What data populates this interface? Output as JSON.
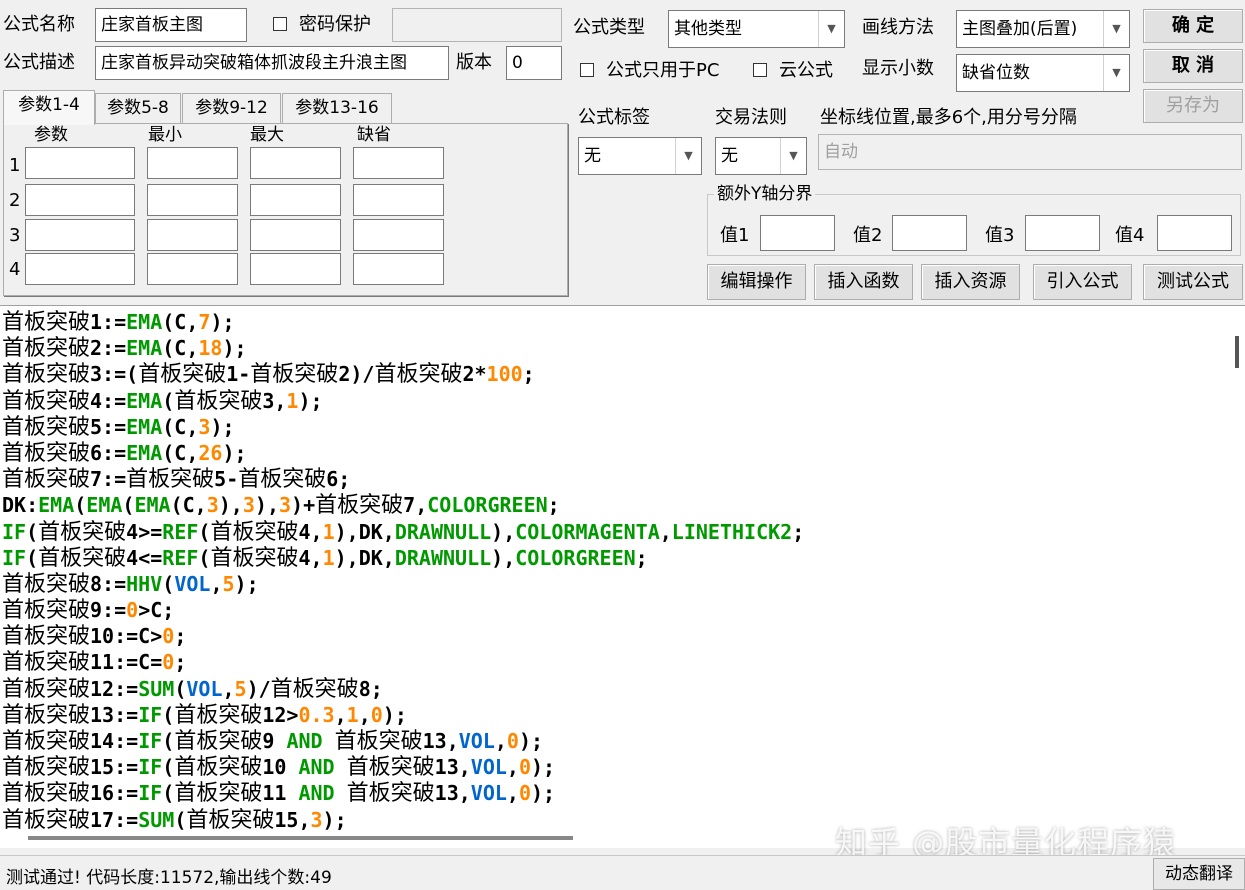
{
  "form": {
    "name_label": "公式名称",
    "name_value": "庄家首板主图",
    "password_label": "密码保护",
    "desc_label": "公式描述",
    "desc_value": "庄家首板异动突破箱体抓波段主升浪主图",
    "version_label": "版本",
    "version_value": "0",
    "type_label": "公式类型",
    "type_value": "其他类型",
    "draw_label": "画线方法",
    "draw_value": "主图叠加(后置)",
    "pc_only_label": "公式只用于PC",
    "cloud_label": "云公式",
    "decimals_label": "显示小数",
    "decimals_value": "缺省位数",
    "tag_label": "公式标签",
    "tag_value": "无",
    "trade_label": "交易法则",
    "trade_value": "无",
    "axis_label": "坐标线位置,最多6个,用分号分隔",
    "axis_value": "自动",
    "extra_y_title": "额外Y轴分界",
    "val1": "值1",
    "val2": "值2",
    "val3": "值3",
    "val4": "值4"
  },
  "buttons": {
    "ok": "确 定",
    "cancel": "取 消",
    "save_as": "另存为",
    "edit_ops": "编辑操作",
    "insert_func": "插入函数",
    "insert_res": "插入资源",
    "import_formula": "引入公式",
    "test_formula": "测试公式"
  },
  "tabs": [
    "参数1-4",
    "参数5-8",
    "参数9-12",
    "参数13-16"
  ],
  "param_headers": [
    "参数",
    "最小",
    "最大",
    "缺省"
  ],
  "param_rows": [
    "1",
    "2",
    "3",
    "4"
  ],
  "code_lines": [
    [
      [
        "c",
        "首板突破"
      ],
      [
        "t",
        "1:="
      ],
      [
        "f",
        "EMA"
      ],
      [
        "t",
        "(C,"
      ],
      [
        "n",
        "7"
      ],
      [
        "t",
        ");"
      ]
    ],
    [
      [
        "c",
        "首板突破"
      ],
      [
        "t",
        "2:="
      ],
      [
        "f",
        "EMA"
      ],
      [
        "t",
        "(C,"
      ],
      [
        "n",
        "18"
      ],
      [
        "t",
        ");"
      ]
    ],
    [
      [
        "c",
        "首板突破"
      ],
      [
        "t",
        "3:=("
      ],
      [
        "c",
        "首板突破"
      ],
      [
        "t",
        "1-"
      ],
      [
        "c",
        "首板突破"
      ],
      [
        "t",
        "2)/"
      ],
      [
        "c",
        "首板突破"
      ],
      [
        "t",
        "2*"
      ],
      [
        "n",
        "100"
      ],
      [
        "t",
        ";"
      ]
    ],
    [
      [
        "c",
        "首板突破"
      ],
      [
        "t",
        "4:="
      ],
      [
        "f",
        "EMA"
      ],
      [
        "t",
        "("
      ],
      [
        "c",
        "首板突破"
      ],
      [
        "t",
        "3,"
      ],
      [
        "n",
        "1"
      ],
      [
        "t",
        ");"
      ]
    ],
    [
      [
        "c",
        "首板突破"
      ],
      [
        "t",
        "5:="
      ],
      [
        "f",
        "EMA"
      ],
      [
        "t",
        "(C,"
      ],
      [
        "n",
        "3"
      ],
      [
        "t",
        ");"
      ]
    ],
    [
      [
        "c",
        "首板突破"
      ],
      [
        "t",
        "6:="
      ],
      [
        "f",
        "EMA"
      ],
      [
        "t",
        "(C,"
      ],
      [
        "n",
        "26"
      ],
      [
        "t",
        ");"
      ]
    ],
    [
      [
        "c",
        "首板突破"
      ],
      [
        "t",
        "7:="
      ],
      [
        "c",
        "首板突破"
      ],
      [
        "t",
        "5-"
      ],
      [
        "c",
        "首板突破"
      ],
      [
        "t",
        "6;"
      ]
    ],
    [
      [
        "t",
        "DK:"
      ],
      [
        "f",
        "EMA"
      ],
      [
        "t",
        "("
      ],
      [
        "f",
        "EMA"
      ],
      [
        "t",
        "("
      ],
      [
        "f",
        "EMA"
      ],
      [
        "t",
        "(C,"
      ],
      [
        "n",
        "3"
      ],
      [
        "t",
        "),"
      ],
      [
        "n",
        "3"
      ],
      [
        "t",
        "),"
      ],
      [
        "n",
        "3"
      ],
      [
        "t",
        ")+"
      ],
      [
        "c",
        "首板突破"
      ],
      [
        "t",
        "7,"
      ],
      [
        "f",
        "COLORGREEN"
      ],
      [
        "t",
        ";"
      ]
    ],
    [
      [
        "f",
        "IF"
      ],
      [
        "t",
        "("
      ],
      [
        "c",
        "首板突破"
      ],
      [
        "t",
        "4>="
      ],
      [
        "f",
        "REF"
      ],
      [
        "t",
        "("
      ],
      [
        "c",
        "首板突破"
      ],
      [
        "t",
        "4,"
      ],
      [
        "n",
        "1"
      ],
      [
        "t",
        "),DK,"
      ],
      [
        "f",
        "DRAWNULL"
      ],
      [
        "t",
        "),"
      ],
      [
        "f",
        "COLORMAGENTA"
      ],
      [
        "t",
        ","
      ],
      [
        "f",
        "LINETHICK2"
      ],
      [
        "t",
        ";"
      ]
    ],
    [
      [
        "f",
        "IF"
      ],
      [
        "t",
        "("
      ],
      [
        "c",
        "首板突破"
      ],
      [
        "t",
        "4<="
      ],
      [
        "f",
        "REF"
      ],
      [
        "t",
        "("
      ],
      [
        "c",
        "首板突破"
      ],
      [
        "t",
        "4,"
      ],
      [
        "n",
        "1"
      ],
      [
        "t",
        "),DK,"
      ],
      [
        "f",
        "DRAWNULL"
      ],
      [
        "t",
        "),"
      ],
      [
        "f",
        "COLORGREEN"
      ],
      [
        "t",
        ";"
      ]
    ],
    [
      [
        "c",
        "首板突破"
      ],
      [
        "t",
        "8:="
      ],
      [
        "f",
        "HHV"
      ],
      [
        "t",
        "("
      ],
      [
        "k",
        "VOL"
      ],
      [
        "t",
        ","
      ],
      [
        "n",
        "5"
      ],
      [
        "t",
        ");"
      ]
    ],
    [
      [
        "c",
        "首板突破"
      ],
      [
        "t",
        "9:="
      ],
      [
        "n",
        "0"
      ],
      [
        "t",
        ">C;"
      ]
    ],
    [
      [
        "c",
        "首板突破"
      ],
      [
        "t",
        "10:=C>"
      ],
      [
        "n",
        "0"
      ],
      [
        "t",
        ";"
      ]
    ],
    [
      [
        "c",
        "首板突破"
      ],
      [
        "t",
        "11:=C="
      ],
      [
        "n",
        "0"
      ],
      [
        "t",
        ";"
      ]
    ],
    [
      [
        "c",
        "首板突破"
      ],
      [
        "t",
        "12:="
      ],
      [
        "f",
        "SUM"
      ],
      [
        "t",
        "("
      ],
      [
        "k",
        "VOL"
      ],
      [
        "t",
        ","
      ],
      [
        "n",
        "5"
      ],
      [
        "t",
        ")/"
      ],
      [
        "c",
        "首板突破"
      ],
      [
        "t",
        "8;"
      ]
    ],
    [
      [
        "c",
        "首板突破"
      ],
      [
        "t",
        "13:="
      ],
      [
        "f",
        "IF"
      ],
      [
        "t",
        "("
      ],
      [
        "c",
        "首板突破"
      ],
      [
        "t",
        "12>"
      ],
      [
        "n",
        "0.3"
      ],
      [
        "t",
        ","
      ],
      [
        "n",
        "1"
      ],
      [
        "t",
        ","
      ],
      [
        "n",
        "0"
      ],
      [
        "t",
        ");"
      ]
    ],
    [
      [
        "c",
        "首板突破"
      ],
      [
        "t",
        "14:="
      ],
      [
        "f",
        "IF"
      ],
      [
        "t",
        "("
      ],
      [
        "c",
        "首板突破"
      ],
      [
        "t",
        "9 "
      ],
      [
        "f",
        "AND"
      ],
      [
        "t",
        " "
      ],
      [
        "c",
        "首板突破"
      ],
      [
        "t",
        "13,"
      ],
      [
        "k",
        "VOL"
      ],
      [
        "t",
        ","
      ],
      [
        "n",
        "0"
      ],
      [
        "t",
        ");"
      ]
    ],
    [
      [
        "c",
        "首板突破"
      ],
      [
        "t",
        "15:="
      ],
      [
        "f",
        "IF"
      ],
      [
        "t",
        "("
      ],
      [
        "c",
        "首板突破"
      ],
      [
        "t",
        "10 "
      ],
      [
        "f",
        "AND"
      ],
      [
        "t",
        " "
      ],
      [
        "c",
        "首板突破"
      ],
      [
        "t",
        "13,"
      ],
      [
        "k",
        "VOL"
      ],
      [
        "t",
        ","
      ],
      [
        "n",
        "0"
      ],
      [
        "t",
        ");"
      ]
    ],
    [
      [
        "c",
        "首板突破"
      ],
      [
        "t",
        "16:="
      ],
      [
        "f",
        "IF"
      ],
      [
        "t",
        "("
      ],
      [
        "c",
        "首板突破"
      ],
      [
        "t",
        "11 "
      ],
      [
        "f",
        "AND"
      ],
      [
        "t",
        " "
      ],
      [
        "c",
        "首板突破"
      ],
      [
        "t",
        "13,"
      ],
      [
        "k",
        "VOL"
      ],
      [
        "t",
        ","
      ],
      [
        "n",
        "0"
      ],
      [
        "t",
        ");"
      ]
    ],
    [
      [
        "c",
        "首板突破"
      ],
      [
        "t",
        "17:="
      ],
      [
        "f",
        "SUM"
      ],
      [
        "t",
        "("
      ],
      [
        "c",
        "首板突破"
      ],
      [
        "t",
        "15,"
      ],
      [
        "n",
        "3"
      ],
      [
        "t",
        ");"
      ]
    ]
  ],
  "status": {
    "message": "测试通过! 代码长度:11572,输出线个数:49",
    "dynamic_translate": "动态翻译"
  },
  "watermark": "知乎 @股市量化程序猿",
  "colors": {
    "function": "#009900",
    "number": "#ff8800",
    "keyword": "#0066cc"
  }
}
